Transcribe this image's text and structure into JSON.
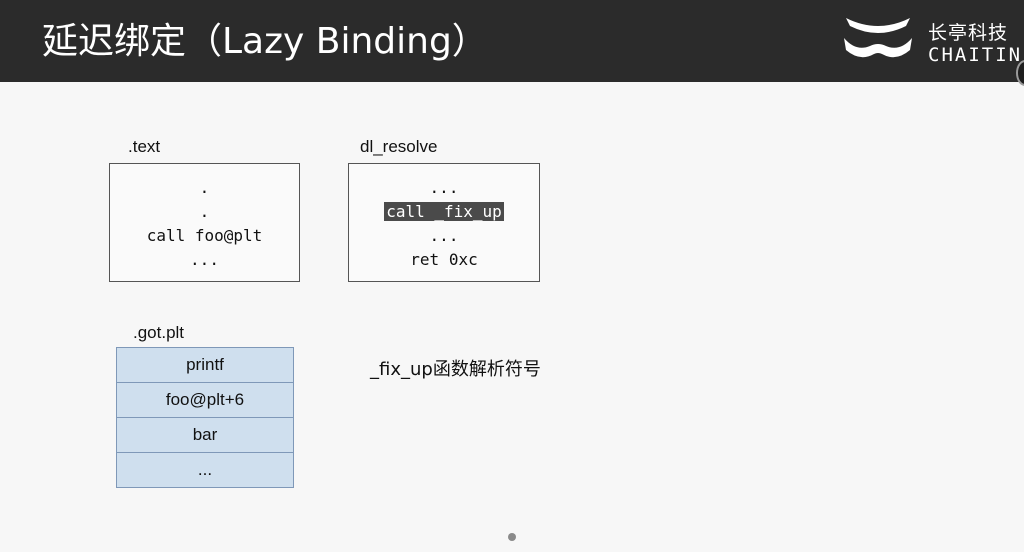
{
  "header": {
    "title": "延迟绑定（Lazy Binding）",
    "logo_cn": "长亭科技",
    "logo_en": "CHAITIN"
  },
  "text_section": {
    "label": ".text",
    "lines": [
      ".",
      ".",
      "call foo@plt",
      "..."
    ]
  },
  "dl_resolve_section": {
    "label": "dl_resolve",
    "lines": [
      "...",
      "call _fix_up",
      "...",
      "ret 0xc"
    ],
    "highlighted_line": "call _fix_up"
  },
  "got_plt_section": {
    "label": ".got.plt",
    "entries": [
      "printf",
      "foo@plt+6",
      "bar",
      "..."
    ]
  },
  "note": "_fix_up函数解析符号",
  "colors": {
    "header_bg": "#2b2b2b",
    "got_cell_bg": "#cfdfee",
    "highlight_bg": "#4a4a4a"
  }
}
